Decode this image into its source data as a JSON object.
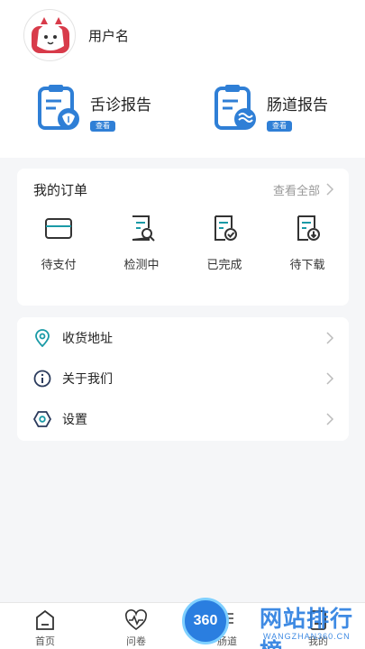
{
  "profile": {
    "username": "用户名"
  },
  "reports": [
    {
      "title": "舌诊报告",
      "badge": "查看"
    },
    {
      "title": "肠道报告",
      "badge": "查看"
    }
  ],
  "orders": {
    "title": "我的订单",
    "view_all": "查看全部",
    "items": [
      {
        "label": "待支付",
        "icon": "card-icon"
      },
      {
        "label": "检测中",
        "icon": "search-document-icon"
      },
      {
        "label": "已完成",
        "icon": "check-document-icon"
      },
      {
        "label": "待下载",
        "icon": "download-document-icon"
      }
    ]
  },
  "menu": [
    {
      "label": "收货地址",
      "icon": "location-pin-icon"
    },
    {
      "label": "关于我们",
      "icon": "info-icon"
    },
    {
      "label": "设置",
      "icon": "settings-icon"
    }
  ],
  "tabbar": [
    {
      "label": "首页",
      "icon": "home-icon"
    },
    {
      "label": "问卷",
      "icon": "heartbeat-icon"
    },
    {
      "label": "肠道",
      "icon": "intestine-icon"
    },
    {
      "label": "我的",
      "icon": "profile-icon"
    }
  ],
  "watermark": {
    "badge": "360",
    "title": "网站排行榜",
    "subtitle": "WANGZHAN360.CN"
  },
  "colors": {
    "accent": "#2f7fd6",
    "page_bg": "#f5f6f8",
    "teal": "#1a9aa6"
  }
}
